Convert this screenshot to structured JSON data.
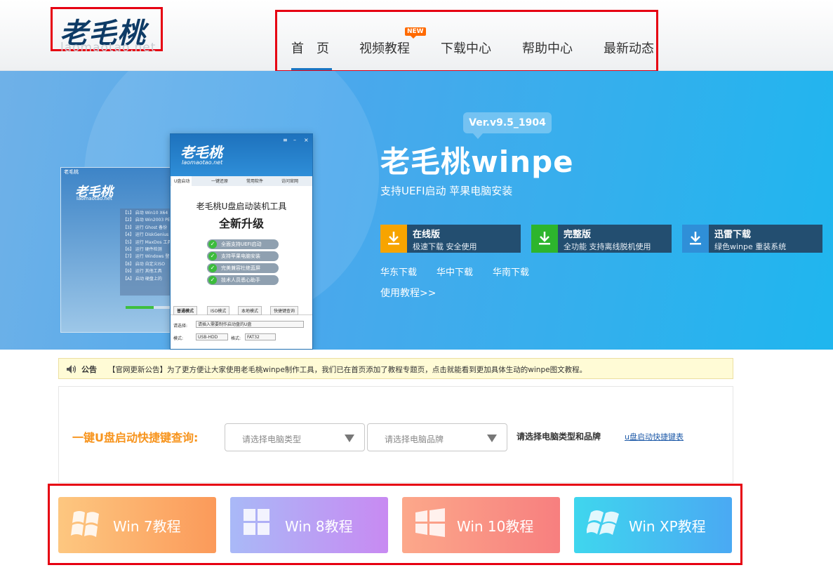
{
  "header": {
    "logo_text": "老毛桃",
    "logo_url": "laomaotao.net",
    "nav": [
      {
        "label": "首　页"
      },
      {
        "label": "视频教程"
      },
      {
        "label": "下载中心"
      },
      {
        "label": "帮助中心"
      },
      {
        "label": "最新动态"
      }
    ],
    "new_badge": "NEW"
  },
  "banner": {
    "version": "Ver.v9.5_1904",
    "product_title": "老毛桃winpe",
    "product_subtitle": "支持UEFI启动 苹果电脑安装",
    "downloads": [
      {
        "name": "在线版",
        "desc": "极速下载 安全使用",
        "color": "#f7a400"
      },
      {
        "name": "完整版",
        "desc": "全功能 支持离线脱机使用",
        "color": "#2db52d"
      },
      {
        "name": "迅雷下载",
        "desc": "绿色winpe 重装系统",
        "color": "#2f8fd8"
      }
    ],
    "mirrors": [
      "华东下载",
      "华中下载",
      "华南下载"
    ],
    "tutorial_link": "使用教程>>",
    "app_window": {
      "logo": "老毛桃",
      "url": "laomaotao.net",
      "tabs": [
        "U盘启动",
        "一键还原",
        "常用软件",
        "访问官网"
      ],
      "title": "老毛桃U盘启动装机工具",
      "subtitle": "全新升级",
      "features": [
        "全面支持UEFI启动",
        "支持苹果电脑安装",
        "完美兼容杜绝蓝屏",
        "技术人员悉心助手"
      ],
      "modes": [
        "普通模式",
        "ISO模式",
        "本地模式",
        "快捷键查询"
      ],
      "select_label": "请选择:",
      "select_value": "请插入需要制作启动盘的U盘",
      "mode_label": "模式:",
      "mode_value": "USB-HDD",
      "format_label": "格式:",
      "format_value": "FAT32"
    },
    "back_window": {
      "title": "老毛桃",
      "logo": "老毛桃",
      "url": "laomaotao.net",
      "menu": [
        "【1】 启动 Win10 X64",
        "【2】 启动 Win2003 PE",
        "【3】 运行 Ghost 备份",
        "【4】 运行 DiskGenius",
        "【5】 运行 MaxDos 工具",
        "【6】 运行 硬件检测",
        "【7】 运行 Windows 登",
        "【8】 启动 自定义ISO",
        "【9】 运行 其他工具",
        "【A】 启动 硬盘上的"
      ]
    }
  },
  "notice": {
    "label": "公告",
    "text": "【官网更新公告】为了更方便让大家使用老毛桃winpe制作工具，我们已在首页添加了教程专题页，点击就能看到更加具体生动的winpe图文教程。"
  },
  "query": {
    "label": "一键U盘启动快捷键查询:",
    "type_placeholder": "请选择电脑类型",
    "brand_placeholder": "请选择电脑品牌",
    "hint": "请选择电脑类型和品牌",
    "link": "u盘启动快捷键表"
  },
  "os_cards": [
    {
      "label": "Win 7教程",
      "icon": "windows7-icon"
    },
    {
      "label": "Win 8教程",
      "icon": "windows8-icon"
    },
    {
      "label": "Win 10教程",
      "icon": "windows10-icon"
    },
    {
      "label": "Win XP教程",
      "icon": "windowsxp-icon"
    }
  ]
}
